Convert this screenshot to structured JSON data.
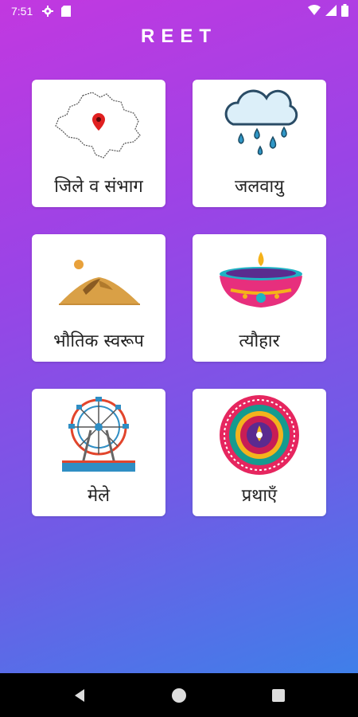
{
  "status_bar": {
    "time": "7:51",
    "left_icons": [
      "gear-icon",
      "sd-card-icon"
    ],
    "right_icons": [
      "wifi-icon",
      "signal-icon",
      "battery-icon"
    ]
  },
  "app": {
    "title": "REET"
  },
  "cards": [
    {
      "label": "जिले व संभाग",
      "icon": "rajasthan-map-icon"
    },
    {
      "label": "जलवायु",
      "icon": "rain-cloud-icon"
    },
    {
      "label": "भौतिक स्वरूप",
      "icon": "desert-dunes-icon"
    },
    {
      "label": "त्यौहार",
      "icon": "diya-lamp-icon"
    },
    {
      "label": "मेले",
      "icon": "ferris-wheel-icon"
    },
    {
      "label": "प्रथाएँ",
      "icon": "rangoli-icon"
    }
  ],
  "navigation": {
    "buttons": [
      "back-icon",
      "home-icon",
      "recents-icon"
    ]
  },
  "colors": {
    "gradient_top": "#c238e0",
    "gradient_bottom": "#3f7fe9",
    "card_bg": "#ffffff"
  }
}
